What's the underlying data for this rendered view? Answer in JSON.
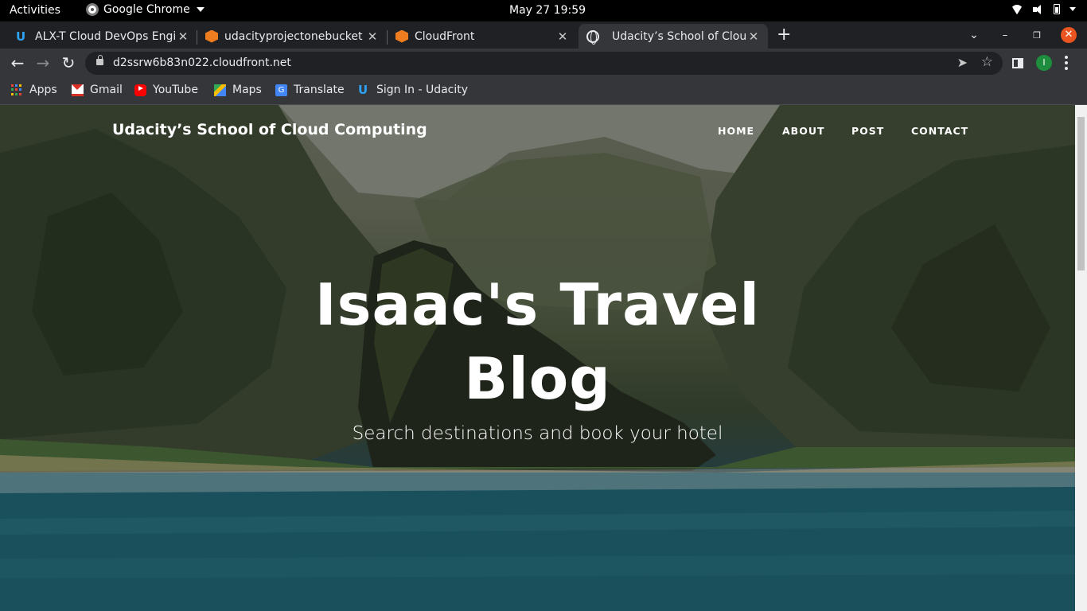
{
  "system_bar": {
    "activities": "Activities",
    "app_name": "Google Chrome",
    "clock": "May 27  19:59"
  },
  "tabs": [
    {
      "title": "ALX-T Cloud DevOps Engi",
      "favicon": "udacity-icon",
      "active": false
    },
    {
      "title": "udacityprojectonebucket",
      "favicon": "aws-icon",
      "active": false
    },
    {
      "title": "CloudFront",
      "favicon": "aws-icon",
      "active": false
    },
    {
      "title": "Udacity’s School of Cloud",
      "favicon": "globe-icon",
      "active": true
    }
  ],
  "toolbar": {
    "url": "d2ssrw6b83n022.cloudfront.net",
    "profile_initial": "I"
  },
  "bookmarks": [
    {
      "label": "Apps",
      "icon": "apps-grid-icon"
    },
    {
      "label": "Gmail",
      "icon": "gmail-icon"
    },
    {
      "label": "YouTube",
      "icon": "youtube-icon"
    },
    {
      "label": "Maps",
      "icon": "maps-icon"
    },
    {
      "label": "Translate",
      "icon": "translate-icon"
    },
    {
      "label": "Sign In - Udacity",
      "icon": "udacity-icon"
    }
  ],
  "site": {
    "brand": "Udacity’s School of Cloud Computing",
    "nav": [
      "HOME",
      "ABOUT",
      "POST",
      "CONTACT"
    ],
    "hero_title_line1": "Isaac's Travel",
    "hero_title_line2": "Blog",
    "hero_subtitle": "Search destinations and book your hotel"
  },
  "colors": {
    "chrome_dark": "#202124",
    "chrome_toolbar": "#35363a",
    "window_close": "#e95420",
    "profile_avatar": "#1e8e3e"
  }
}
